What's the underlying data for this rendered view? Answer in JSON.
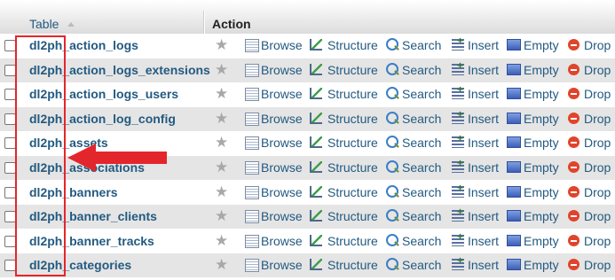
{
  "header": {
    "table_label": "Table",
    "action_label": "Action"
  },
  "actions": {
    "browse": "Browse",
    "structure": "Structure",
    "search": "Search",
    "insert": "Insert",
    "empty": "Empty",
    "drop": "Drop"
  },
  "rows": [
    {
      "name": "dl2ph_action_logs"
    },
    {
      "name": "dl2ph_action_logs_extensions"
    },
    {
      "name": "dl2ph_action_logs_users"
    },
    {
      "name": "dl2ph_action_log_config"
    },
    {
      "name": "dl2ph_assets"
    },
    {
      "name": "dl2ph_associations"
    },
    {
      "name": "dl2ph_banners"
    },
    {
      "name": "dl2ph_banner_clients"
    },
    {
      "name": "dl2ph_banner_tracks"
    },
    {
      "name": "dl2ph_categories"
    }
  ],
  "colors": {
    "link": "#235a81",
    "highlight_box": "#e3262c",
    "arrow": "#e3262c"
  }
}
